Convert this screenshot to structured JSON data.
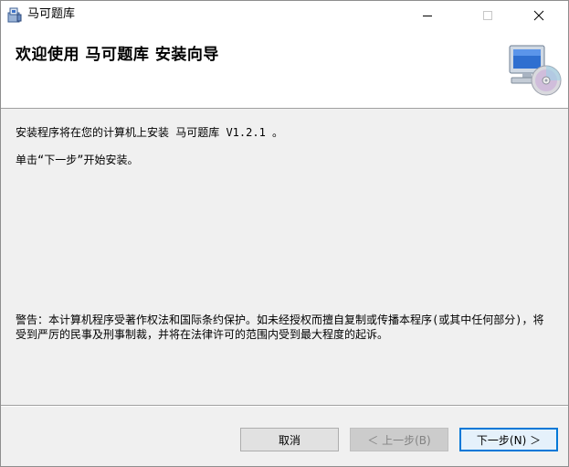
{
  "window": {
    "title": "马可题库",
    "controls": {
      "minimize": "minimize",
      "maximize": "maximize",
      "close": "close"
    }
  },
  "banner": {
    "title": "欢迎使用 马可题库 安装向导"
  },
  "body": {
    "intro": "安装程序将在您的计算机上安装 马可题库 V1.2.1 。",
    "instruction": "单击“下一步”开始安装。",
    "warning": "警告：本计算机程序受著作权法和国际条约保护。如未经授权而擅自复制或传播本程序(或其中任何部分)，将受到严厉的民事及刑事制裁，并将在法律许可的范围内受到最大程度的起诉。"
  },
  "buttons": {
    "cancel": "取消",
    "back": "＜ 上一步(B)",
    "next": "下一步(N) ＞"
  },
  "colors": {
    "accent": "#0078d7",
    "dialog_bg": "#f0f0f0"
  }
}
